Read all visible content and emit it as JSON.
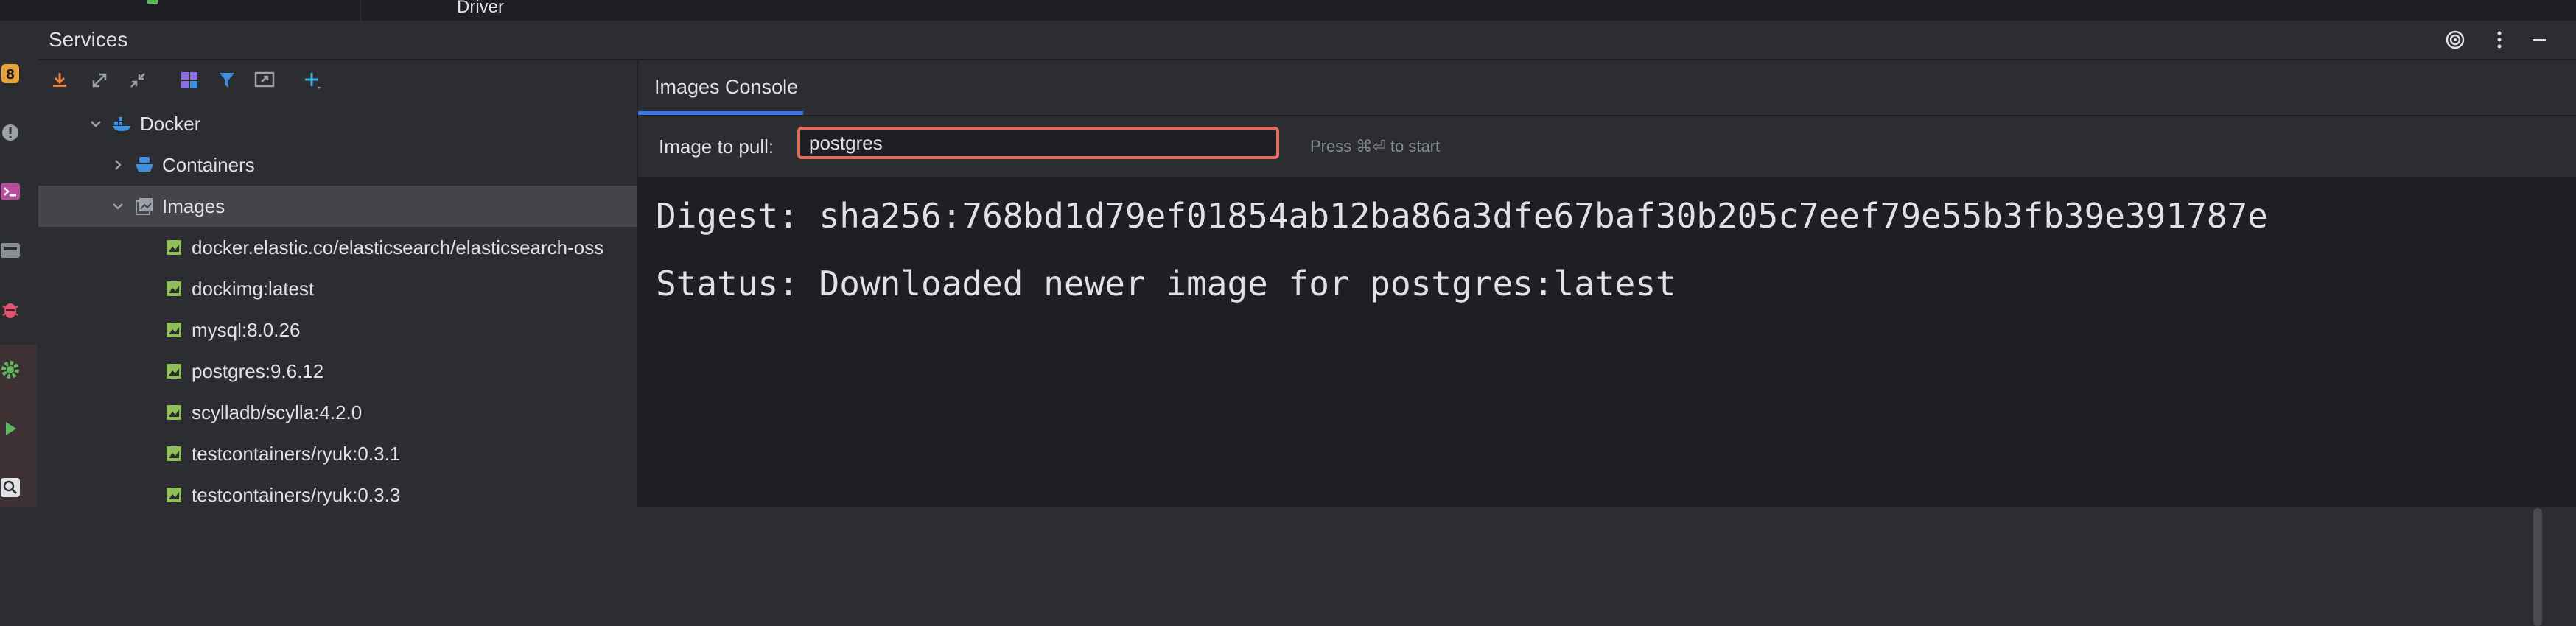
{
  "top_strip": {
    "label": "Driver"
  },
  "left_bar": {
    "badge": "8"
  },
  "services": {
    "title": "Services"
  },
  "tree": {
    "root": "Docker",
    "containers": "Containers",
    "images": "Images",
    "image_items": [
      "docker.elastic.co/elasticsearch/elasticsearch-oss",
      "dockimg:latest",
      "mysql:8.0.26",
      "postgres:9.6.12",
      "scylladb/scylla:4.2.0",
      "testcontainers/ryuk:0.3.1",
      "testcontainers/ryuk:0.3.3"
    ]
  },
  "console": {
    "tab": "Images Console",
    "pull_label": "Image to pull:",
    "pull_value": "postgres",
    "pull_hint": "Press ⌘⏎ to start",
    "lines": [
      "Digest: sha256:768bd1d79ef01854ab12ba86a3dfe67baf30b205c7eef79e55b3fb39e391787e",
      "Status: Downloaded newer image for postgres:latest"
    ]
  },
  "colors": {
    "accent": "#3574f0",
    "input_border": "#e06c5a",
    "image_icon": "#8fbf5a",
    "docker_icon": "#3f8fe0"
  }
}
